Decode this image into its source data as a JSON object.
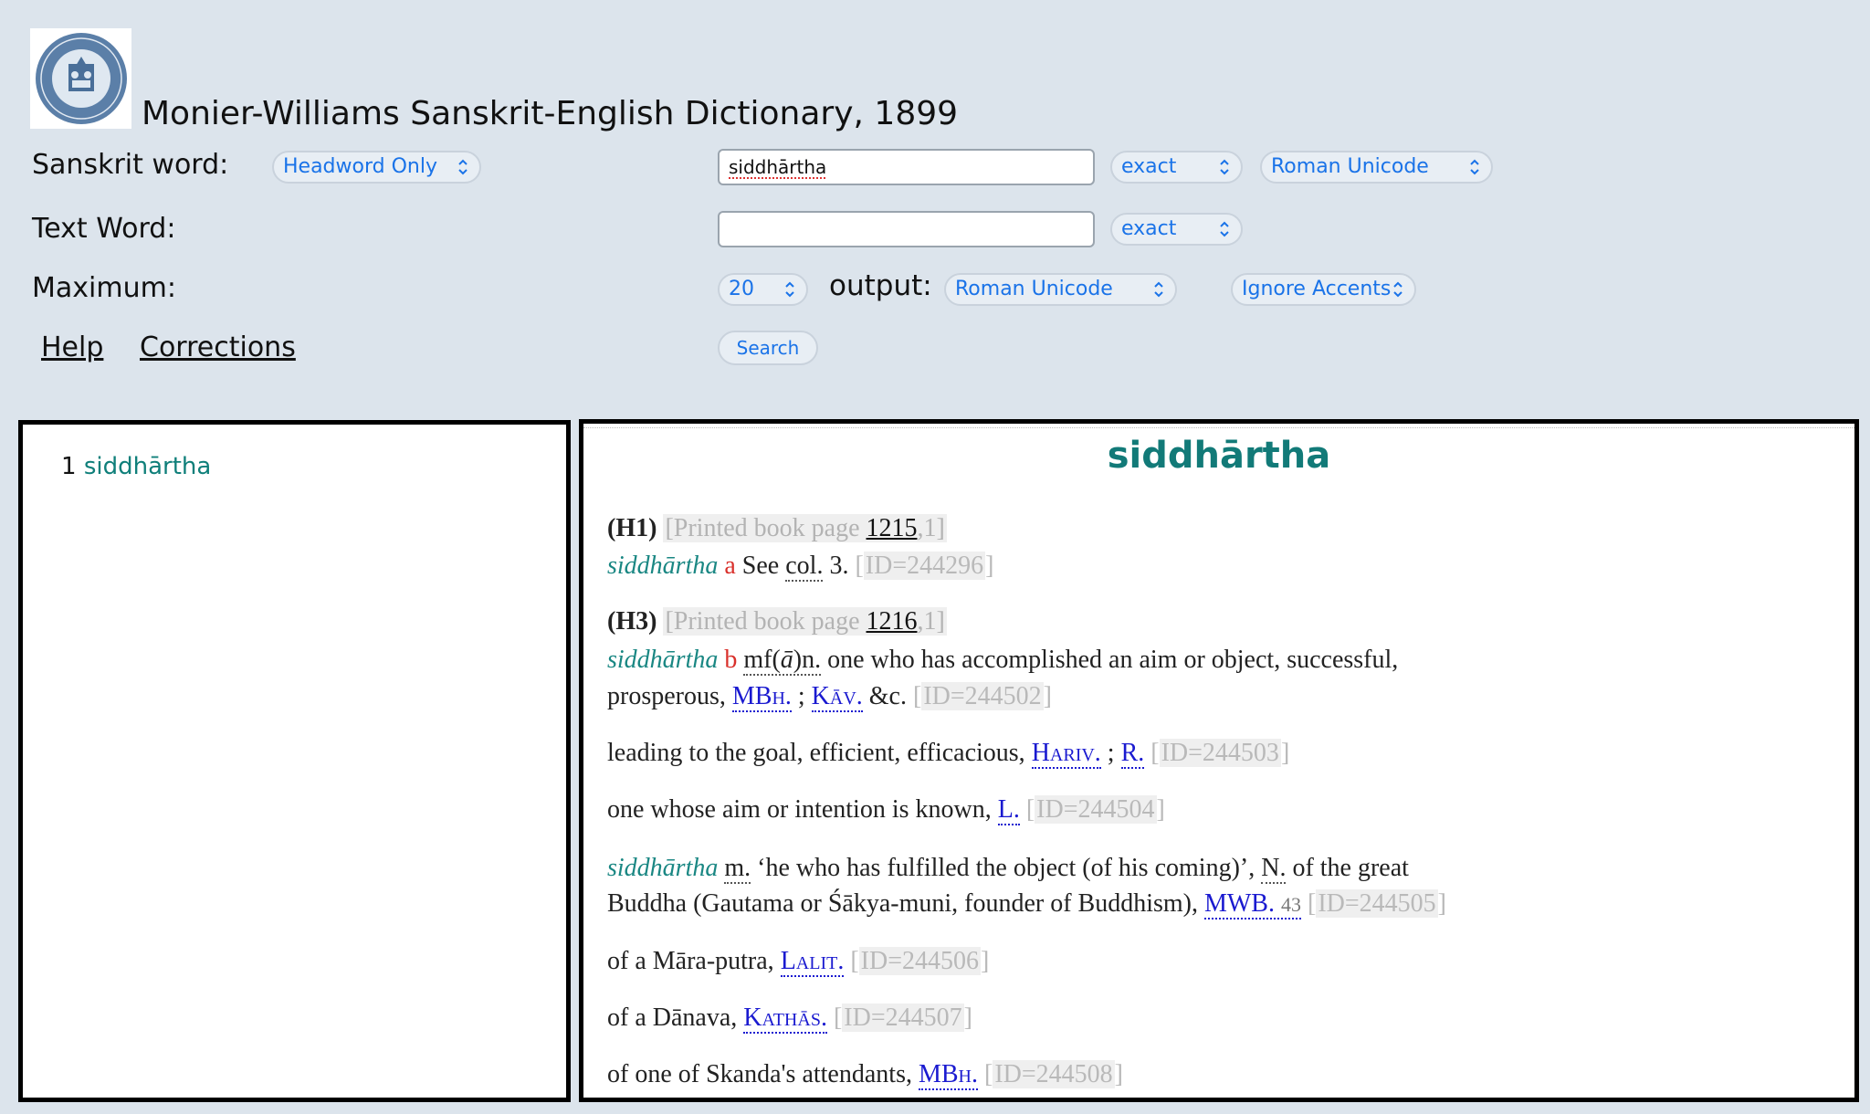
{
  "header": {
    "title": "Monier-Williams Sanskrit-English Dictionary, 1899"
  },
  "form": {
    "sanskrit_word_label": "Sanskrit word:",
    "headword_select": "Headword Only",
    "sanskrit_input_value": "siddhārtha",
    "sanskrit_match_select": "exact",
    "sanskrit_input_encoding": "Roman Unicode",
    "text_word_label": "Text Word:",
    "text_input_value": "",
    "text_match_select": "exact",
    "maximum_label": "Maximum:",
    "maximum_select": "20",
    "output_label": "output:",
    "output_select": "Roman Unicode",
    "accent_select": "Ignore Accents",
    "help_link": "Help",
    "corrections_link": "Corrections",
    "search_button": "Search"
  },
  "results_list": [
    {
      "num": "1",
      "word": "siddhārtha"
    }
  ],
  "entry": {
    "headword": "siddhārtha",
    "h1": {
      "label": "(H1)",
      "page_open": "[Printed book page ",
      "page": "1215",
      "page_close": ",1]"
    },
    "line1": {
      "hw": "siddhārtha",
      "letter": "a",
      "see": "See",
      "col": "col.",
      "rest": "3.",
      "id": "ID=244296"
    },
    "h3": {
      "label": "(H3)",
      "page_open": "[Printed book page ",
      "page": "1216",
      "page_close": ",1]"
    },
    "line2a": {
      "hw": "siddhārtha",
      "letter": "b",
      "mf": "mf(",
      "a": "ā",
      "n": ")n.",
      "text": "one who has accomplished an aim or object, successful,"
    },
    "line2b": {
      "text": "prosperous,",
      "src1": "MBh.",
      "sep": ";",
      "src2": "Kāv.",
      "etc": "&c.",
      "id": "ID=244502"
    },
    "line3": {
      "text": "leading to the goal, efficient, efficacious,",
      "src1": "Hariv.",
      "sep": ";",
      "src2": "R.",
      "id": "ID=244503"
    },
    "line4": {
      "text": "one whose aim or intention is known,",
      "src1": "L.",
      "id": "ID=244504"
    },
    "line5a": {
      "hw": "siddhārtha",
      "m": "m.",
      "text1": "‘he who has fulfilled the object (of his coming)’,",
      "n": "N.",
      "text2": "of the great"
    },
    "line5b": {
      "text": "Buddha (Gautama or Śākya-muni, founder of Buddhism),",
      "src1": "MWB.",
      "num": "43",
      "id": "ID=244505"
    },
    "line6": {
      "text": "of a Māra-putra,",
      "src1": "Lalit.",
      "id": "ID=244506"
    },
    "line7": {
      "text": "of a Dānava,",
      "src1": "Kathās.",
      "id": "ID=244507"
    },
    "line8": {
      "text": "of one of Skanda's attendants,",
      "src1": "MBh.",
      "id": "ID=244508"
    }
  },
  "colors": {
    "background": "#dce4ec",
    "accent": "#1a73e8",
    "headword": "#127a78",
    "source_link": "#1a1ad0",
    "letter": "#d9302b"
  },
  "icons": {
    "logo": "university-seal-logo",
    "select_chevron": "updown-chevron-icon"
  }
}
